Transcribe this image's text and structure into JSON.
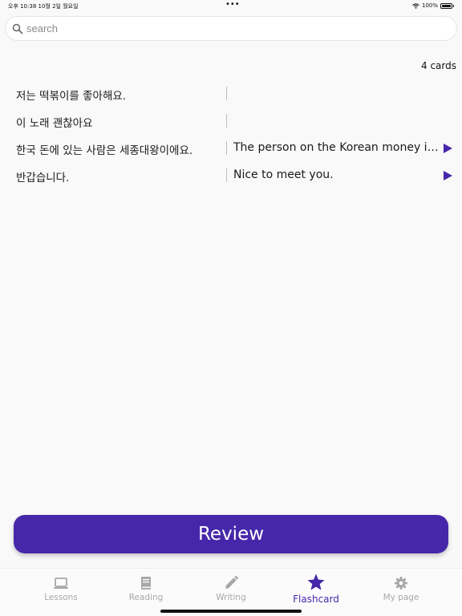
{
  "status_bar": {
    "time": "오후 10:38   10월 2일 월요일",
    "dots": "•••",
    "battery": "100%"
  },
  "search": {
    "placeholder": "search"
  },
  "card_count": "4 cards",
  "cards": [
    {
      "korean": "저는 떡볶이를 좋아해요.",
      "english": ""
    },
    {
      "korean": "이 노래 괜찮아요",
      "english": ""
    },
    {
      "korean": "한국 돈에 있는 사람은 세종대왕이에요.",
      "english": "The person on the Korean money is King Sejong the Great."
    },
    {
      "korean": "반갑습니다.",
      "english": "Nice to meet you."
    }
  ],
  "review_button": "Review",
  "tabs": [
    {
      "label": "Lessons",
      "icon": "laptop-icon"
    },
    {
      "label": "Reading",
      "icon": "book-icon"
    },
    {
      "label": "Writing",
      "icon": "pencil-icon"
    },
    {
      "label": "Flashcard",
      "icon": "star-icon",
      "active": true
    },
    {
      "label": "My page",
      "icon": "gear-icon"
    }
  ],
  "colors": {
    "accent": "#4727a9",
    "inactive": "#a7a7a7",
    "background": "#f9f9f9"
  }
}
